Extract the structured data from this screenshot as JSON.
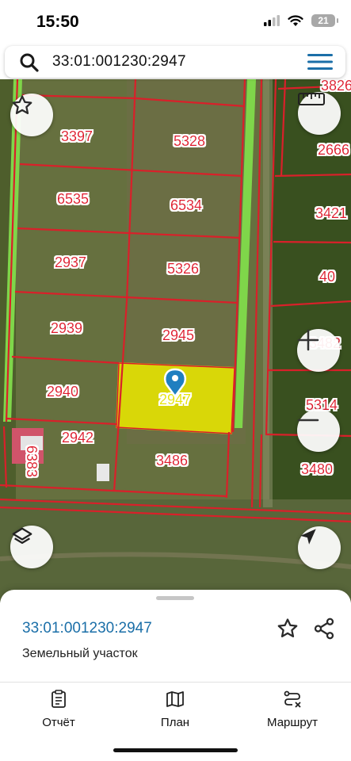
{
  "status_bar": {
    "time": "15:50",
    "battery": "21"
  },
  "search": {
    "query": "33:01:001230:2947"
  },
  "map": {
    "parcels": [
      {
        "label": "3397"
      },
      {
        "label": "5328"
      },
      {
        "label": "3826"
      },
      {
        "label": "2666"
      },
      {
        "label": "6535"
      },
      {
        "label": "6534"
      },
      {
        "label": "3421"
      },
      {
        "label": "2937"
      },
      {
        "label": "5326"
      },
      {
        "label": "40"
      },
      {
        "label": "2939"
      },
      {
        "label": "2945"
      },
      {
        "label": "3482"
      },
      {
        "label": "2940"
      },
      {
        "label": "2947"
      },
      {
        "label": "5314"
      },
      {
        "label": "2942"
      },
      {
        "label": "3486"
      },
      {
        "label": "3480"
      },
      {
        "label": "6383"
      }
    ],
    "selected_parcel": "2947",
    "colors": {
      "boundary": "#d9202a",
      "selected_fill": "#e8e600",
      "road_strip": "#7fd64a",
      "pin": "#1f7fc0"
    }
  },
  "controls": {
    "favorite_icon": "star-outline-icon",
    "ruler_icon": "ruler-icon",
    "zoom_in_icon": "plus-icon",
    "zoom_out_icon": "minus-icon",
    "layers_icon": "layers-icon",
    "locate_icon": "navigation-arrow-icon"
  },
  "sheet": {
    "title": "33:01:001230:2947",
    "subtitle": "Земельный участок"
  },
  "tabs": [
    {
      "label": "Отчёт",
      "icon": "report-icon"
    },
    {
      "label": "План",
      "icon": "map-icon"
    },
    {
      "label": "Маршрут",
      "icon": "route-icon"
    }
  ]
}
